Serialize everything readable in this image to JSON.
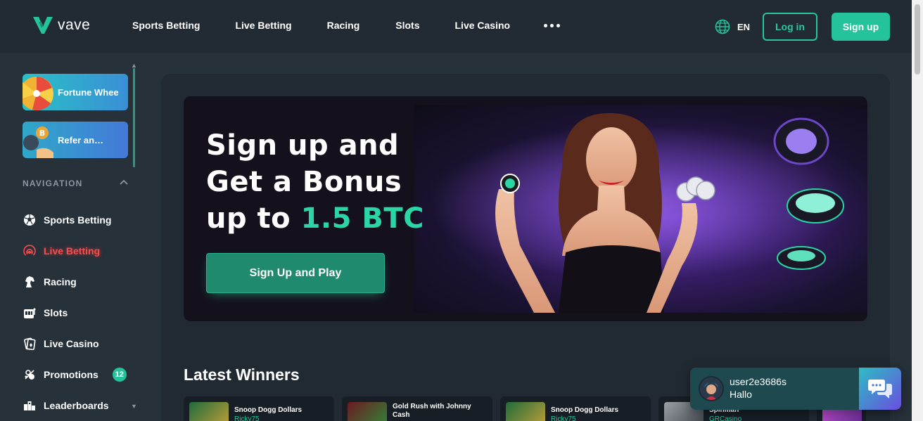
{
  "header": {
    "logo_text": "vave",
    "nav": [
      "Sports Betting",
      "Live Betting",
      "Racing",
      "Slots",
      "Live Casino"
    ],
    "more_icon": "ellipsis-icon",
    "language": "EN",
    "login_label": "Log in",
    "signup_label": "Sign up"
  },
  "sidebar": {
    "promos": [
      {
        "label": "Fortune Whee",
        "icon": "fortune-wheel-icon"
      },
      {
        "label": "Refer an…",
        "icon": "refer-coins-icon"
      }
    ],
    "nav_heading": "NAVIGATION",
    "items": [
      {
        "label": "Sports Betting",
        "icon": "soccer-ball-icon"
      },
      {
        "label": "Live Betting",
        "icon": "live-signal-icon",
        "active": true
      },
      {
        "label": "Racing",
        "icon": "horse-icon"
      },
      {
        "label": "Slots",
        "icon": "slot-machine-icon"
      },
      {
        "label": "Live Casino",
        "icon": "cards-icon"
      },
      {
        "label": "Promotions",
        "icon": "promotions-icon",
        "badge": "12"
      },
      {
        "label": "Leaderboards",
        "icon": "leaderboard-icon"
      }
    ]
  },
  "hero": {
    "line1": "Sign up and",
    "line2": "Get a Bonus",
    "line3_prefix": "up to ",
    "line3_accent": "1.5 BTC",
    "cta_label": "Sign Up and Play"
  },
  "winners": {
    "title": "Latest Winners",
    "cards": [
      {
        "game": "Snoop Dogg Dollars",
        "user": "Ricky75"
      },
      {
        "game": "Gold Rush with Johnny Cash",
        "user": ""
      },
      {
        "game": "Snoop Dogg Dollars",
        "user": "Ricky75"
      },
      {
        "game": "Spinman",
        "user": "GRCasino"
      }
    ]
  },
  "chat": {
    "user": "user2e3686s",
    "message": "Hallo"
  },
  "colors": {
    "accent": "#25c39b",
    "live": "#ff4a4a",
    "background": "#27313a"
  }
}
